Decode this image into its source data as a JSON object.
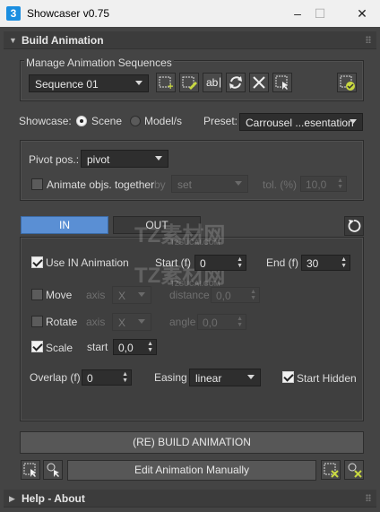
{
  "window": {
    "title": "Showcaser v0.75",
    "icon_text": "3"
  },
  "build_animation": {
    "header": "Build Animation",
    "sequences": {
      "group_label": "Manage Animation Sequences",
      "selected": "Sequence 01",
      "rename_label": "ab"
    },
    "showcase_label": "Showcase:",
    "scene_label": "Scene",
    "models_label": "Model/s",
    "preset_label": "Preset:",
    "preset_value": "Carrousel ...esentation",
    "pivot_label": "Pivot pos.:",
    "pivot_value": "pivot",
    "animate_together_label": "Animate objs. together",
    "by_label": "by",
    "by_value": "set",
    "tol_label": "tol. (%)",
    "tol_value": "10,0",
    "tab_in": "IN",
    "tab_out": "OUT",
    "use_in_label": "Use IN Animation",
    "start_f_label": "Start (f)",
    "start_f_value": "0",
    "end_f_label": "End (f)",
    "end_f_value": "30",
    "move_label": "Move",
    "axis_label": "axis",
    "move_axis": "X",
    "distance_label": "distance",
    "distance_value": "0,0",
    "rotate_label": "Rotate",
    "rotate_axis": "X",
    "angle_label": "angle",
    "angle_value": "0,0",
    "scale_label": "Scale",
    "scale_start_label": "start",
    "scale_start_value": "0,0",
    "overlap_label": "Overlap (f)",
    "overlap_value": "0",
    "easing_label": "Easing",
    "easing_value": "linear",
    "start_hidden_label": "Start Hidden",
    "build_button": "(RE) BUILD ANIMATION",
    "edit_button": "Edit Animation Manually"
  },
  "help": {
    "header": "Help - About"
  },
  "watermark": {
    "big": "TZ素材网",
    "small": "TZSUCAI.COM"
  },
  "colors": {
    "accent": "#5a8fd4",
    "panel": "#444444",
    "field": "#2e2e2e"
  }
}
